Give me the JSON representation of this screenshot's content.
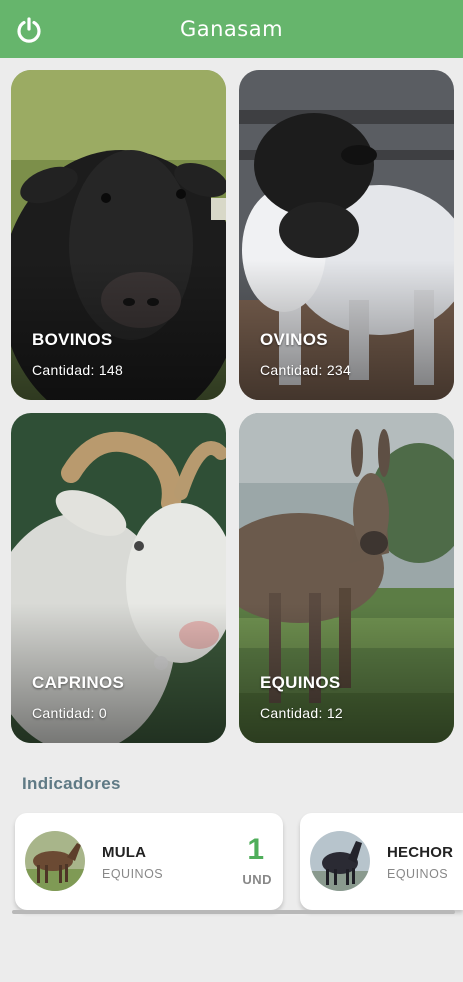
{
  "app": {
    "title": "Ganasam",
    "accent": "#66b56c"
  },
  "categories": [
    {
      "name": "BOVINOS",
      "count_label": "Cantidad: 148",
      "count": 148
    },
    {
      "name": "OVINOS",
      "count_label": "Cantidad: 234",
      "count": 234
    },
    {
      "name": "CAPRINOS",
      "count_label": "Cantidad: 0",
      "count": 0
    },
    {
      "name": "EQUINOS",
      "count_label": "Cantidad: 12",
      "count": 12
    }
  ],
  "indicators": {
    "title": "Indicadores",
    "items": [
      {
        "name": "MULA",
        "category": "EQUINOS",
        "value": "1",
        "unit": "UND"
      },
      {
        "name": "HECHOR",
        "category": "EQUINOS"
      }
    ]
  }
}
